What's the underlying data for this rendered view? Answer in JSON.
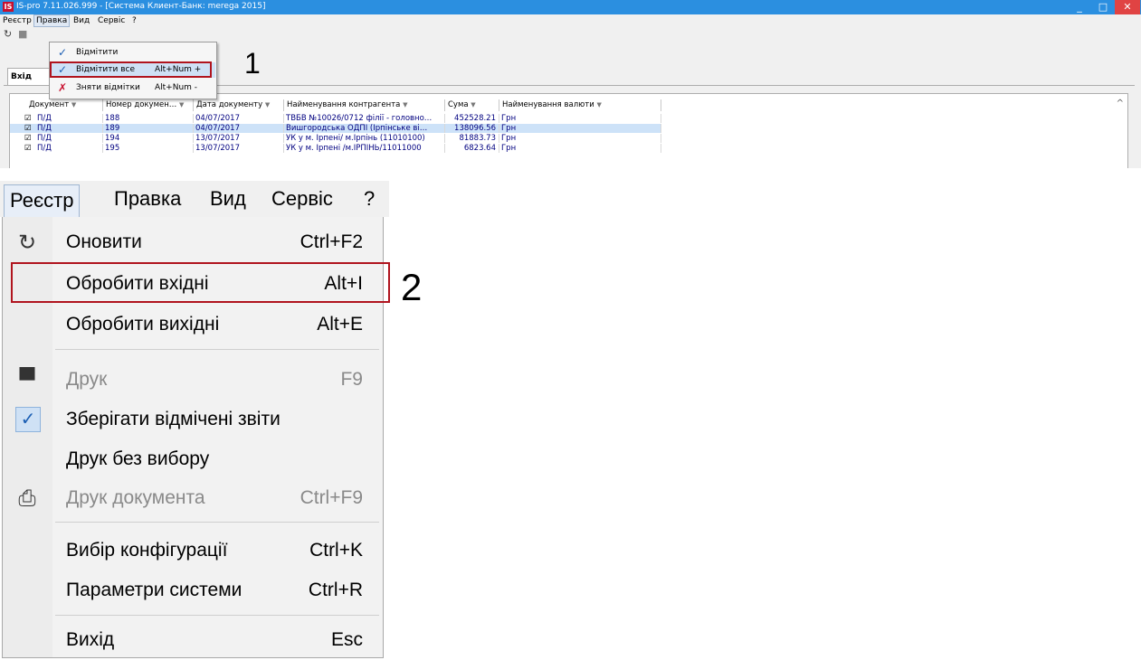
{
  "window": {
    "app_icon": "IS",
    "title": "IS-pro 7.11.026.999 - [Система Клиент-Банк: merega 2015]",
    "controls": {
      "minimize": "_",
      "maximize": "□",
      "close": "✕"
    }
  },
  "menubar": {
    "items": [
      "Реєстр",
      "Правка",
      "Вид",
      "Сервіс",
      "?"
    ]
  },
  "tab": {
    "label": "Вхід"
  },
  "edit_menu": {
    "items": [
      {
        "label": "Відмітити",
        "shortcut": "",
        "icon": "check-icon"
      },
      {
        "label": "Відмітити все",
        "shortcut": "Alt+Num +",
        "icon": "check-all-icon"
      },
      {
        "label": "Зняти відмітки",
        "shortcut": "Alt+Num -",
        "icon": "uncheck-icon"
      }
    ]
  },
  "callouts": {
    "one": "1",
    "two": "2"
  },
  "grid": {
    "columns": [
      "Документ",
      "Номер докумен…",
      "Дата документу",
      "Найменування контрагента",
      "Сума",
      "Найменування валюти"
    ],
    "rows": [
      {
        "doc": "П/Д",
        "number": "188",
        "date": "04/07/2017",
        "counterparty": "ТВБВ №10026/0712 філії - головно…",
        "sum": "452528.21",
        "currency": "Грн",
        "checked": true,
        "selected": false
      },
      {
        "doc": "П/Д",
        "number": "189",
        "date": "04/07/2017",
        "counterparty": "Вишгородська ОДПІ (Ірпінське ві…",
        "sum": "138096.56",
        "currency": "Грн",
        "checked": true,
        "selected": true
      },
      {
        "doc": "П/Д",
        "number": "194",
        "date": "13/07/2017",
        "counterparty": "УК у м. Ірпені/ м.Ірпінь (11010100)",
        "sum": "81883.73",
        "currency": "Грн",
        "checked": true,
        "selected": false
      },
      {
        "doc": "П/Д",
        "number": "195",
        "date": "13/07/2017",
        "counterparty": "УК у м. Ірпені /м.ІРПІНЬ/11011000",
        "sum": "6823.64",
        "currency": "Грн",
        "checked": true,
        "selected": false
      }
    ]
  },
  "registry_menu": {
    "bar": [
      "Реєстр",
      "Правка",
      "Вид",
      "Сервіс",
      "?"
    ],
    "items": [
      {
        "label": "Оновити",
        "shortcut": "Ctrl+F2",
        "icon": "refresh-icon",
        "disabled": false
      },
      {
        "label": "Обробити вхідні",
        "shortcut": "Alt+I",
        "icon": "",
        "disabled": false
      },
      {
        "label": "Обробити вихідні",
        "shortcut": "Alt+E",
        "icon": "",
        "disabled": false
      },
      {
        "label": "Друк",
        "shortcut": "F9",
        "icon": "printer-icon",
        "disabled": true
      },
      {
        "label": "Зберігати відмічені звіти",
        "shortcut": "",
        "icon": "checkbox-checked-icon",
        "disabled": false
      },
      {
        "label": "Друк без вибору",
        "shortcut": "",
        "icon": "",
        "disabled": false
      },
      {
        "label": "Друк документа",
        "shortcut": "Ctrl+F9",
        "icon": "print-document-icon",
        "disabled": true
      },
      {
        "label": "Вибір конфігурації",
        "shortcut": "Ctrl+K",
        "icon": "",
        "disabled": false
      },
      {
        "label": "Параметри системи",
        "shortcut": "Ctrl+R",
        "icon": "",
        "disabled": false
      },
      {
        "label": "Вихід",
        "shortcut": "Esc",
        "icon": "",
        "disabled": false
      }
    ]
  },
  "colors": {
    "titlebar": "#2b8fe0",
    "highlight_box": "#b0141e",
    "selection": "#cde2f8"
  }
}
